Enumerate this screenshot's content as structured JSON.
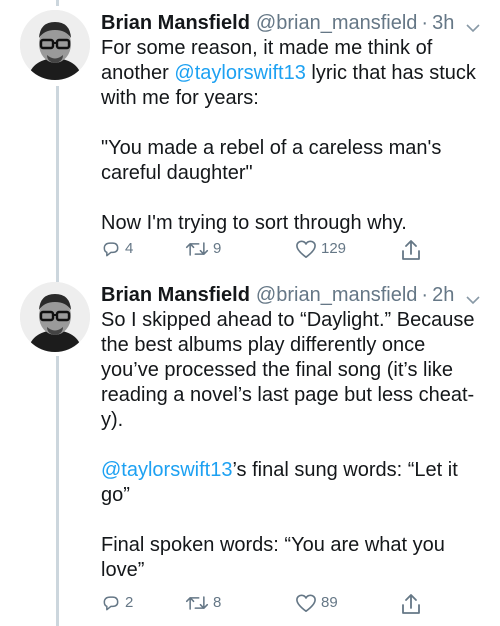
{
  "tweets": [
    {
      "author": {
        "name": "Brian Mansfield",
        "handle": "@brian_mansfield",
        "avatar_icon": "avatar-man-glasses"
      },
      "time": "3h",
      "body": {
        "l1": "For some reason, it made me think of",
        "l2a": "another ",
        "l2b": "@taylorswift13",
        "l2c": " lyric that has stuck",
        "l3": "with me for years:",
        "l4": "\"You made a rebel of a careless man's",
        "l5": "careful daughter\"",
        "l6": "Now I'm trying to sort through why."
      },
      "actions": {
        "replies": "4",
        "retweets": "9",
        "likes": "129"
      }
    },
    {
      "author": {
        "name": "Brian Mansfield",
        "handle": "@brian_mansfield",
        "avatar_icon": "avatar-man-glasses"
      },
      "time": "2h",
      "body": {
        "l1": "So I skipped ahead to “Daylight.” Because",
        "l2": "the best albums play differently once",
        "l3": "you’ve processed the final song (it’s like",
        "l4": "reading a novel’s last page but less cheat-",
        "l5": "y).",
        "l6a": "@taylorswift13",
        "l6b": "’s final sung words: “Let it",
        "l7": "go”",
        "l8": "Final spoken words: “You are what you",
        "l9": "love”"
      },
      "actions": {
        "replies": "2",
        "retweets": "8",
        "likes": "89"
      }
    }
  ],
  "colors": {
    "text": "#14171a",
    "secondary": "#657786",
    "link": "#1da1f2",
    "thread_line": "#ccd6dd"
  }
}
